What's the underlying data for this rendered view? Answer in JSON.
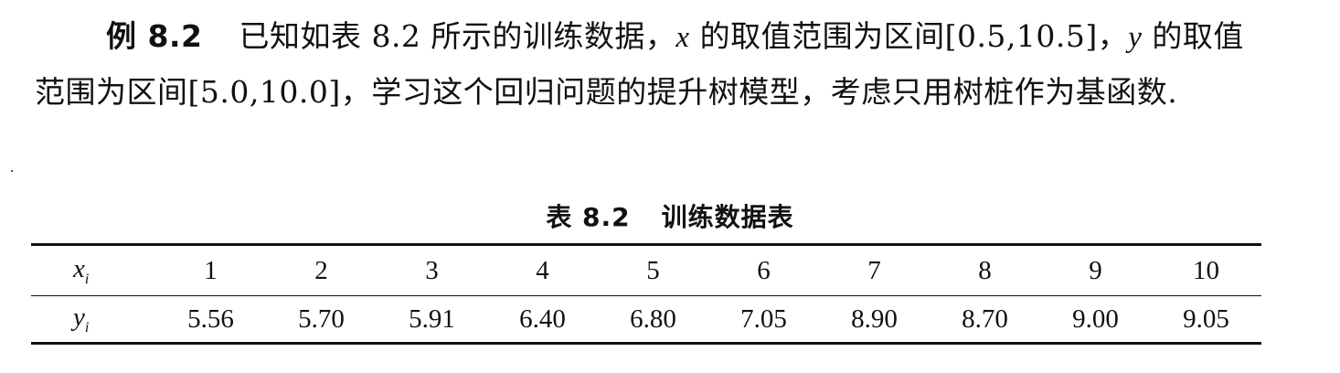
{
  "paragraph": {
    "example_label": "例 8.2",
    "part1": "已知如表 8.2 所示的训练数据，",
    "var_x": "x",
    "part2": " 的取值范围为区间[0.5,10.5]，",
    "var_y": "y",
    "part3": " 的取值范围为区间[5.0,10.0]，学习这个回归问题的提升树模型，考虑只用树桩作为基函数."
  },
  "table": {
    "caption_number": "表 8.2",
    "caption_title": "训练数据表",
    "row_x_label": "x",
    "row_y_label": "y",
    "sub": "i",
    "x_values": [
      "1",
      "2",
      "3",
      "4",
      "5",
      "6",
      "7",
      "8",
      "9",
      "10"
    ],
    "y_values": [
      "5.56",
      "5.70",
      "5.91",
      "6.40",
      "6.80",
      "7.05",
      "8.90",
      "8.70",
      "9.00",
      "9.05"
    ]
  }
}
